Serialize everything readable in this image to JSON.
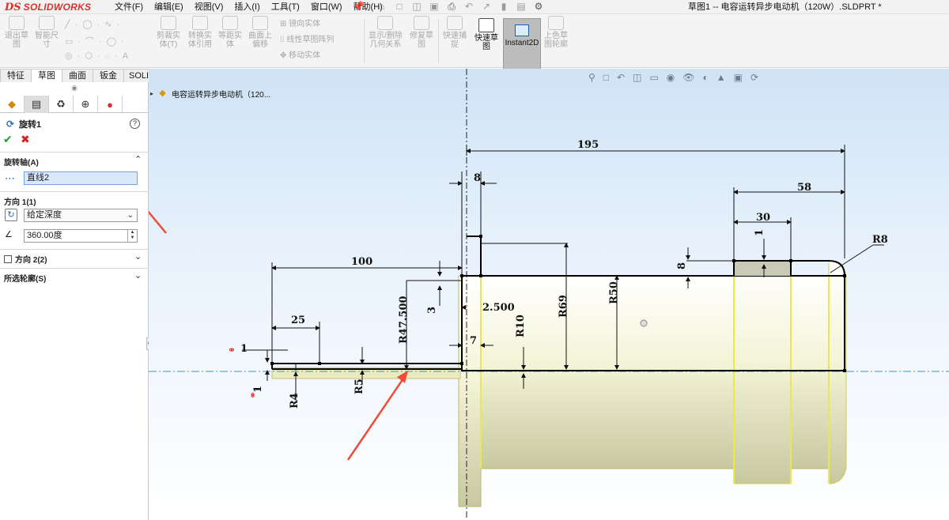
{
  "app": {
    "logo_ds": "DS",
    "logo_name": "SOLIDWORKS",
    "menu": [
      "文件(F)",
      "编辑(E)",
      "视图(V)",
      "插入(I)",
      "工具(T)",
      "窗口(W)",
      "帮助(H)"
    ],
    "document_title": "草图1 -- 电容运转异步电动机（120W）.SLDPRT *"
  },
  "ribbon": {
    "exit_sketch": "退出草\n图",
    "smart_dim": "智能尺\n寸",
    "trim": "剪裁实\n体(T)",
    "convert": "转换实\n体引用",
    "offset_equal": "等距实\n体",
    "offset_surface": "曲面上\n偏移",
    "mirror": "镜向实体",
    "linear_pattern": "线性草图阵列",
    "move": "移动实体",
    "relations": "显示/删除\n几何关系",
    "repair": "修复草\n图",
    "quick_snap": "快速捕\n捉",
    "rapid_sketch": "快速草\n图",
    "instant2d": "Instant2D",
    "shaded_contours": "上色草\n图轮廓"
  },
  "tabs": [
    "特征",
    "草图",
    "曲面",
    "钣金",
    "SOLIDWORKS 插件"
  ],
  "panel": {
    "feature_name": "旋转1",
    "help": "?",
    "axis_section": "旋转轴(A)",
    "axis_value": "直线2",
    "direction1_section": "方向 1(1)",
    "direction1_type": "给定深度",
    "angle_value": "360.00度",
    "direction2_section": "方向 2(2)",
    "contours_section": "所选轮廓(S)"
  },
  "viewport": {
    "tree_item": "电容运转异步电动机（120...",
    "dimensions": {
      "d195": "195",
      "d8_top": "8",
      "d58": "58",
      "d30": "30",
      "d1_top": "1",
      "r8": "R8",
      "d8_side": "8",
      "d100": "100",
      "d3": "3",
      "d2_500": "2.500",
      "r47": "R47.500",
      "r69": "R69",
      "r50": "R50",
      "d25": "25",
      "r10": "R10",
      "d7": "7",
      "d1_left": "1",
      "d1_low": "1",
      "r4": "R4",
      "r5": "R5"
    }
  },
  "colors": {
    "brand_red": "#d4322c",
    "sketch_line": "#000000",
    "centerline": "#4a8fc8",
    "shaded_body": "#e8e8b0",
    "arrow": "#ef4b36"
  }
}
